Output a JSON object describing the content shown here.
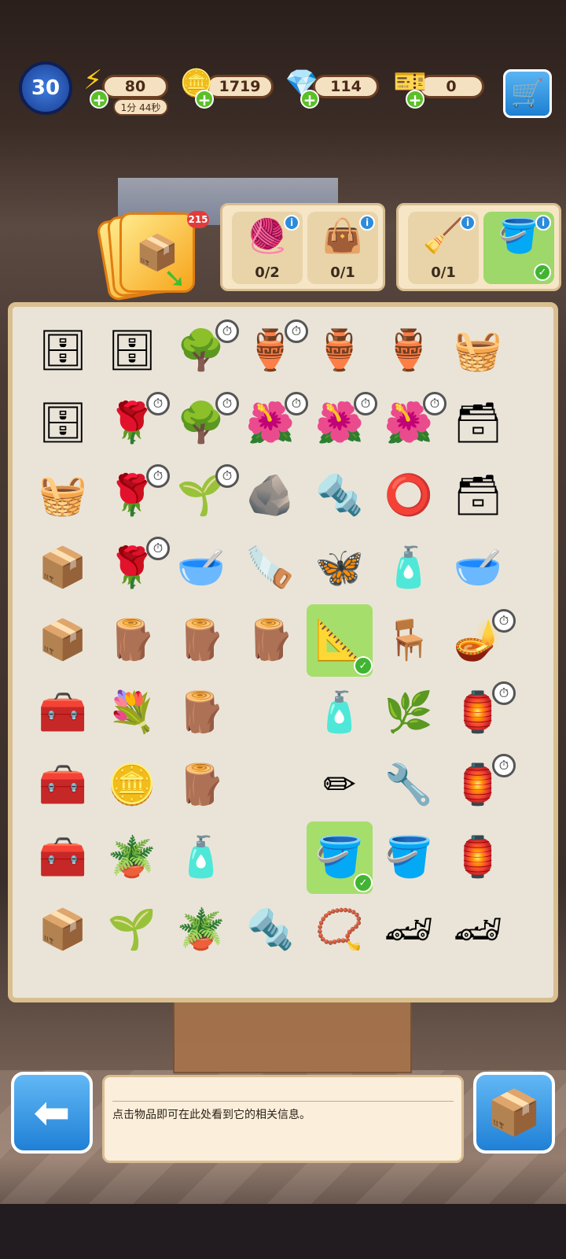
{
  "hud": {
    "level": "30",
    "energy": "80",
    "energy_timer": "1分 44秒",
    "coins": "1719",
    "gems": "114",
    "tickets": "0",
    "icons": {
      "energy": "lightning-icon",
      "coins": "coin-icon",
      "gems": "gem-icon",
      "tickets": "ticket-icon",
      "cart": "shopping-cart-icon"
    }
  },
  "deck": {
    "count": "215"
  },
  "orders": [
    {
      "requirements": [
        {
          "icon": "yarn-balls",
          "count": "0/2",
          "done": false
        },
        {
          "icon": "cloth-bag",
          "count": "0/1",
          "done": false
        }
      ]
    },
    {
      "requirements": [
        {
          "icon": "mop",
          "count": "0/1",
          "done": false
        },
        {
          "icon": "pink-bucket",
          "count": "",
          "done": true
        }
      ]
    }
  ],
  "board": {
    "rows": [
      [
        "cabinet",
        "open-cabinet",
        "tree",
        "vase",
        "blue-vase",
        "blue-vase",
        "fruit-dresser",
        ""
      ],
      [
        "locked-cabinet",
        "rose-bush",
        "tree",
        "flower-pot",
        "flower-pot",
        "flower-pot",
        "wood-drawers",
        ""
      ],
      [
        "tool-basket",
        "rose-bush",
        "sapling",
        "gravel",
        "drill-bit",
        "stone-ring",
        "wood-drawers",
        ""
      ],
      [
        "screw-crate",
        "rose-bush",
        "pink-bowl",
        "table-saw",
        "moth",
        "cleaner-bottle",
        "clay-bowl",
        ""
      ],
      [
        "screw-crate",
        "logs",
        "planks",
        "log",
        "set-square",
        "stool",
        "clay-lamp",
        ""
      ],
      [
        "toolbox-blue",
        "pink-flowers",
        "wood-block",
        "",
        "spray-bottle",
        "seedling",
        "lantern",
        ""
      ],
      [
        "toolbox-blue",
        "gold-coins",
        "plank-stack",
        "",
        "pencil",
        "wrench",
        "lantern-kit",
        ""
      ],
      [
        "toolbox-red",
        "potted-plant",
        "soap-bottle",
        "",
        "pink-bucket",
        "paint-bucket",
        "lantern-spool",
        ""
      ],
      [
        "wood-box",
        "seed-pot",
        "soil-pot",
        "screws",
        "lockets",
        "race-car",
        "race-car",
        ""
      ]
    ]
  },
  "info_panel": {
    "text": "点击物品即可在此处看到它的相关信息。"
  },
  "colors": {
    "accent_blue": "#1f80d6",
    "board_bg": "#eae4d8",
    "highlight_green": "#a6de6c",
    "badge_red": "#e23b3b"
  }
}
